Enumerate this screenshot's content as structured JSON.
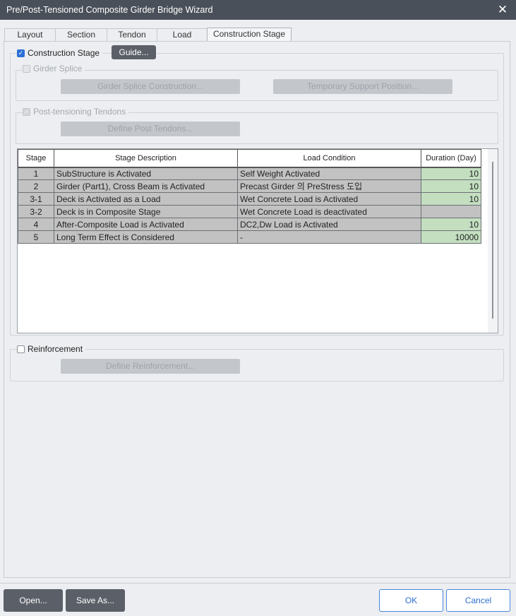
{
  "window": {
    "title": "Pre/Post-Tensioned Composite Girder Bridge Wizard"
  },
  "tabs": [
    {
      "label": "Layout",
      "active": false
    },
    {
      "label": "Section",
      "active": false
    },
    {
      "label": "Tendon",
      "active": false
    },
    {
      "label": "Load",
      "active": false
    },
    {
      "label": "Construction Stage",
      "active": true
    }
  ],
  "construction_stage": {
    "label": "Construction Stage",
    "checked": true,
    "guide_button": "Guide..."
  },
  "girder_splice": {
    "label": "Girder Splice",
    "checked": false,
    "enabled": false,
    "construction_button": "Girder Splice Construction...",
    "temporary_support_button": "Temporary Support Position..."
  },
  "post_tensioning": {
    "label": "Post-tensioning Tendons",
    "checked": true,
    "enabled": false,
    "define_button": "Define Post Tendons..."
  },
  "stage_table": {
    "headers": {
      "stage": "Stage",
      "description": "Stage Description",
      "load_condition": "Load Condition",
      "duration": "Duration (Day)"
    },
    "rows": [
      {
        "stage": "1",
        "description": "SubStructure is Activated",
        "load_condition": "Self Weight Activated",
        "duration": "10"
      },
      {
        "stage": "2",
        "description": "Girder (Part1), Cross Beam is Activated",
        "load_condition": "Precast Girder 의 PreStress 도입",
        "duration": "10"
      },
      {
        "stage": "3-1",
        "description": "Deck is Activated as a Load",
        "load_condition": "Wet Concrete Load is Activated",
        "duration": "10"
      },
      {
        "stage": "3-2",
        "description": "Deck is in Composite Stage",
        "load_condition": "Wet Concrete Load is deactivated",
        "duration": ""
      },
      {
        "stage": "4",
        "description": "After-Composite Load is Activated",
        "load_condition": "DC2,Dw Load is Activated",
        "duration": "10"
      },
      {
        "stage": "5",
        "description": "Long Term Effect is Considered",
        "load_condition": "-",
        "duration": "10000"
      }
    ]
  },
  "reinforcement": {
    "label": "Reinforcement",
    "checked": false,
    "define_button": "Define Reinforcement..."
  },
  "footer": {
    "open_button": "Open...",
    "save_as_button": "Save As...",
    "ok_button": "OK",
    "cancel_button": "Cancel"
  },
  "colors": {
    "titlebar": "#4a5059",
    "duration_cell": "#c3dfc0",
    "readonly_cell": "#c2c2c2",
    "accent": "#2b6fd6"
  }
}
